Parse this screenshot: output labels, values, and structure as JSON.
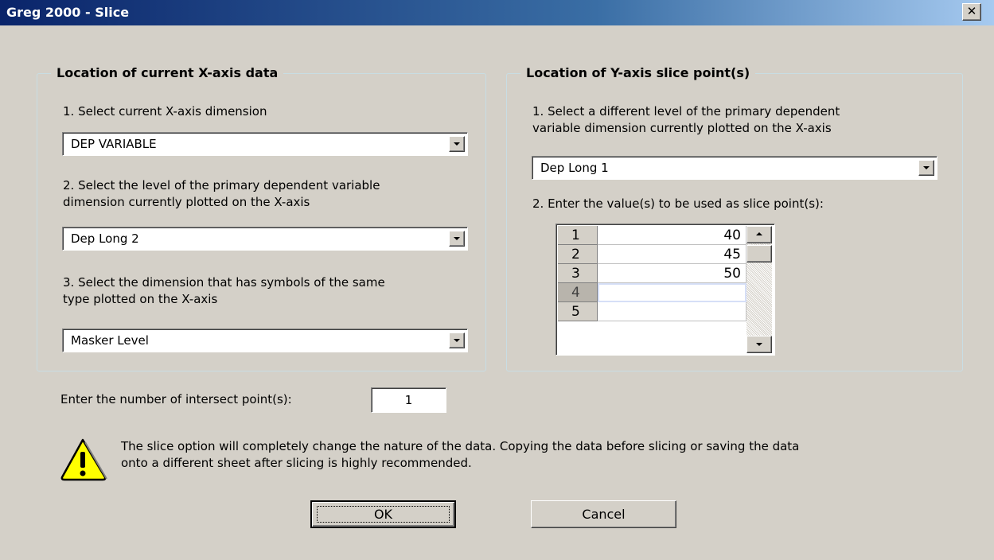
{
  "window": {
    "title": "Greg 2000 - Slice",
    "close_glyph": "✕"
  },
  "x_axis_group": {
    "title": "Location of current X-axis data",
    "step1_label": "1. Select current X-axis dimension",
    "step1_value": "DEP VARIABLE",
    "step2_label_line1": "2. Select the level of the primary dependent variable",
    "step2_label_line2": "dimension currently plotted on the X-axis",
    "step2_value": "Dep Long 2",
    "step3_label_line1": "3. Select the dimension that has symbols of the same",
    "step3_label_line2": "type plotted on the X-axis",
    "step3_value": "Masker Level"
  },
  "y_axis_group": {
    "title": "Location of Y-axis slice point(s)",
    "step1_label_line1": "1. Select a different level of the primary dependent",
    "step1_label_line2": "variable dimension currently plotted on the X-axis",
    "step1_value": "Dep Long 1",
    "step2_label": "2. Enter the value(s) to be used as slice point(s):",
    "grid_rows": [
      {
        "index": "1",
        "value": "40"
      },
      {
        "index": "2",
        "value": "45"
      },
      {
        "index": "3",
        "value": "50"
      },
      {
        "index": "4",
        "value": ""
      },
      {
        "index": "5",
        "value": ""
      }
    ]
  },
  "intersect": {
    "label": "Enter the number of intersect point(s):",
    "value": "1"
  },
  "warning": {
    "icon": "warning-triangle-icon",
    "line1": "The slice option will completely change the nature of the data. Copying the data before slicing or saving the data",
    "line2": "onto a different sheet after slicing is highly recommended."
  },
  "buttons": {
    "ok": "OK",
    "cancel": "Cancel"
  },
  "colors": {
    "title_gradient_start": "#0a246a",
    "title_gradient_end": "#a6caf0",
    "dialog_bg": "#d4d0c8",
    "warning_yellow": "#ffff00"
  }
}
